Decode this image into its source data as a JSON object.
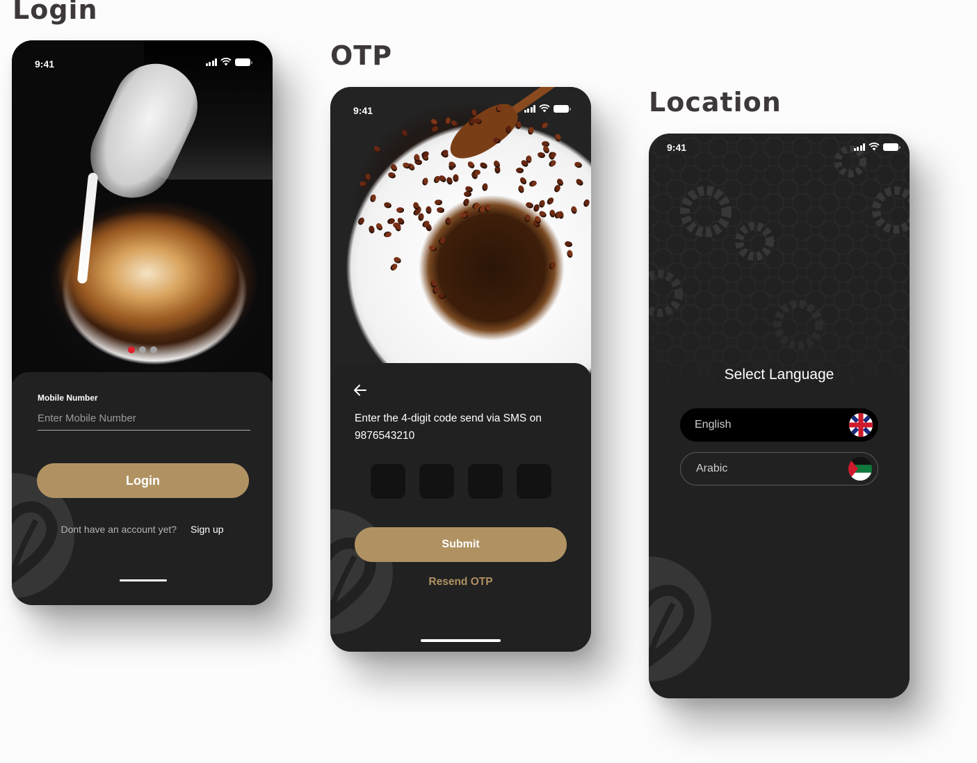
{
  "sections": {
    "login_title": "Login",
    "otp_title": "OTP",
    "location_title": "Location"
  },
  "status_bar": {
    "time": "9:41"
  },
  "login_screen": {
    "carousel": {
      "total_slides": 3,
      "active_index": 0
    },
    "mobile_label": "Mobile Number",
    "mobile_placeholder": "Enter Mobile Number",
    "mobile_value": "",
    "login_button": "Login",
    "signup_prompt": "Dont have an account yet?",
    "signup_link": "Sign up"
  },
  "otp_screen": {
    "message": "Enter the 4-digit code send via SMS on 9876543210",
    "message_line1": "Enter the 4-digit code send via SMS on",
    "phone_number": "9876543210",
    "otp_digits": [
      "",
      "",
      "",
      ""
    ],
    "submit_button": "Submit",
    "resend_link": "Resend OTP"
  },
  "location_screen": {
    "title": "Select Language",
    "languages": [
      {
        "label": "English",
        "flag": "uk-flag",
        "selected": true
      },
      {
        "label": "Arabic",
        "flag": "palestine-flag",
        "selected": false
      }
    ]
  },
  "colors": {
    "accent_gold": "#b09262",
    "dot_active": "#e0202d",
    "dot_inactive": "#a3a3a3",
    "sheet_bg": "#212121",
    "title_text": "#3d383b"
  }
}
